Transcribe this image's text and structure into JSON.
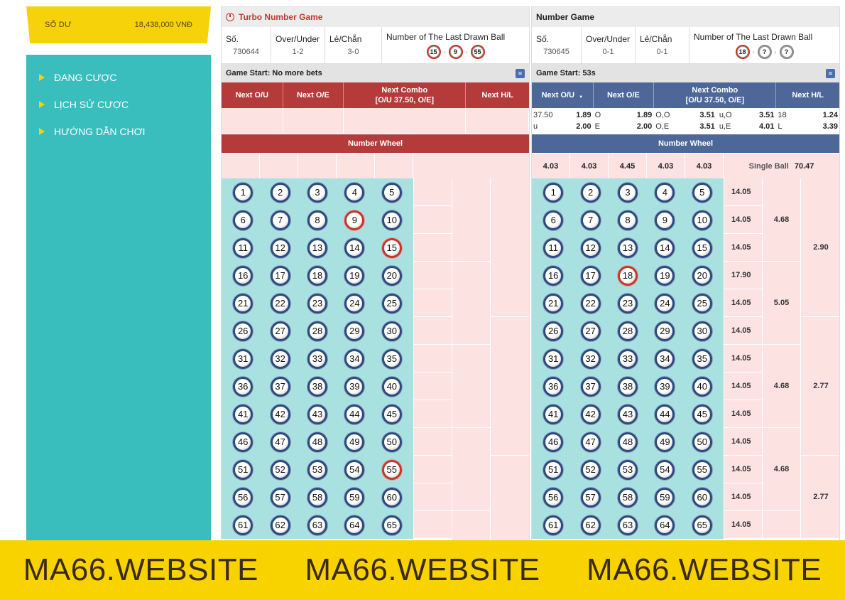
{
  "balance": {
    "label": "SỐ DƯ",
    "value": "18,438,000 VNĐ"
  },
  "nav": [
    {
      "label": "ĐANG CƯỢC"
    },
    {
      "label": "LỊCH SỬ CƯỢC"
    },
    {
      "label": "HƯỚNG DẪN CHƠI"
    }
  ],
  "panel1": {
    "title": "Turbo Number Game",
    "info": {
      "so_label": "Số.",
      "so": "730644",
      "ou_label": "Over/Under",
      "ou": "1-2",
      "le_label": "Lẻ/Chẵn",
      "le": "3-0",
      "last_label": "Number of The Last Drawn Ball",
      "last": [
        "15",
        "9",
        "55"
      ]
    },
    "status": "Game Start: No more bets",
    "headers": [
      "Next O/U",
      "Next O/E",
      "Next Combo\n[O/U 37.50, O/E]",
      "Next H/L"
    ],
    "wheel_title": "Number Wheel",
    "hot": [
      9,
      15,
      55
    ]
  },
  "panel2": {
    "title": "Number Game",
    "info": {
      "so_label": "Số.",
      "so": "730645",
      "ou_label": "Over/Under",
      "ou": "0-1",
      "le_label": "Lẻ/Chẵn",
      "le": "0-1",
      "last_label": "Number of The Last Drawn Ball",
      "last": [
        "18",
        "?",
        "?"
      ]
    },
    "status": "Game Start: 53s",
    "headers": [
      "Next O/U",
      "Next O/E",
      "Next Combo\n[O/U 37.50, O/E]",
      "Next H/L"
    ],
    "sort_icon": "▼",
    "odds": {
      "ou": [
        [
          "37.50",
          "1.89"
        ],
        [
          "u",
          "2.00"
        ]
      ],
      "oe": [
        [
          "O",
          "1.89"
        ],
        [
          "E",
          "2.00"
        ]
      ],
      "combo": [
        [
          "O,O",
          "3.51",
          "u,O",
          "3.51"
        ],
        [
          "O,E",
          "3.51",
          "u,E",
          "4.01"
        ]
      ],
      "hl": [
        [
          "18",
          "1.24"
        ],
        [
          "L",
          "3.39"
        ]
      ]
    },
    "wheel_title": "Number Wheel",
    "wheel_odds": [
      "4.03",
      "4.03",
      "4.45",
      "4.03",
      "4.03"
    ],
    "single_ball_label": "Single Ball",
    "single_ball": "70.47",
    "row_odds": [
      "14.05",
      "14.05",
      "14.05",
      "17.90",
      "14.05",
      "14.05",
      "14.05",
      "14.05",
      "14.05",
      "14.05",
      "14.05",
      "14.05",
      "14.05"
    ],
    "group_odds": [
      "4.68",
      "5.05",
      "4.68",
      "4.68"
    ],
    "half_odds": [
      "2.90",
      "2.77",
      "2.77"
    ],
    "hot": [
      18
    ]
  },
  "watermark": [
    "MA66.WEBSITE",
    "MA66.WEBSITE",
    "MA66.WEBSITE"
  ]
}
